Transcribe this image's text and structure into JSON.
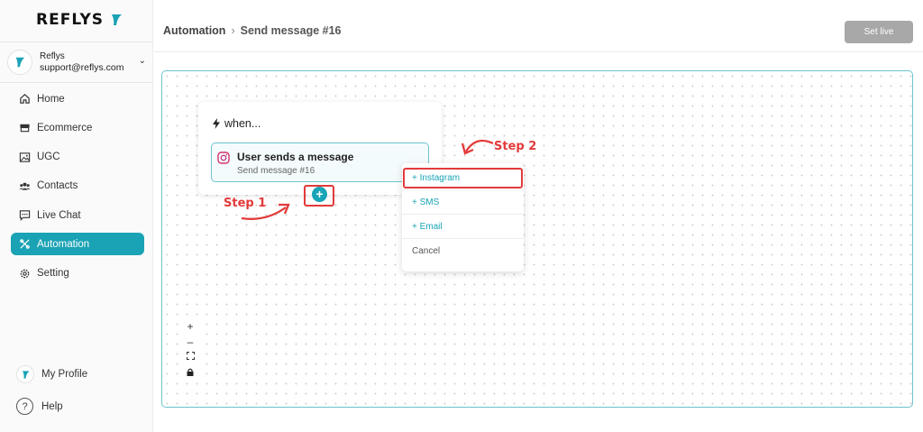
{
  "brand": {
    "name": "REFLYS",
    "accent": "#1aa2b5",
    "annotation_color": "#e33a3a"
  },
  "account": {
    "name": "Reflys",
    "email": "support@reflys.com"
  },
  "sidebar": {
    "items": [
      {
        "label": "Home",
        "icon": "home-icon"
      },
      {
        "label": "Ecommerce",
        "icon": "store-icon"
      },
      {
        "label": "UGC",
        "icon": "image-icon"
      },
      {
        "label": "Contacts",
        "icon": "users-icon"
      },
      {
        "label": "Live Chat",
        "icon": "chat-icon"
      },
      {
        "label": "Automation",
        "icon": "automation-icon",
        "active": true
      },
      {
        "label": "Setting",
        "icon": "gear-icon"
      }
    ],
    "profile_label": "My Profile",
    "help_label": "Help"
  },
  "header": {
    "breadcrumb_root": "Automation",
    "breadcrumb_current": "Send message #16",
    "set_live_label": "Set live"
  },
  "canvas": {
    "trigger": {
      "when_label": "when...",
      "title": "User sends a message",
      "subtitle": "Send message #16"
    },
    "add_button": "+",
    "menu": {
      "instagram": "+ Instagram",
      "sms": "+ SMS",
      "email": "+ Email",
      "cancel": "Cancel"
    },
    "annotations": {
      "step1": "Step 1",
      "step2": "Step 2"
    },
    "zoom_controls": {
      "zoom_in": "+",
      "zoom_out": "–",
      "fit": "⛶",
      "lock": "🔒"
    }
  }
}
